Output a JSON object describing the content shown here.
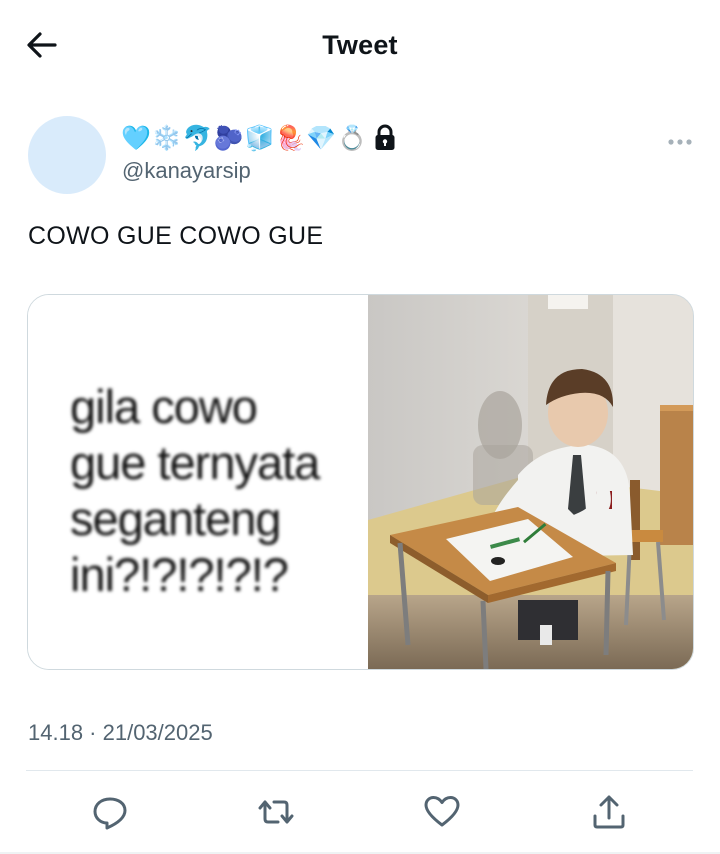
{
  "header": {
    "title": "Tweet",
    "back_icon": "arrow-left-icon"
  },
  "tweet": {
    "display_name_emojis": [
      "🩵",
      "❄️",
      "🐬",
      "🫐",
      "🧊",
      "🪼",
      "💎",
      "💍"
    ],
    "lock_icon": "lock-icon",
    "handle": "@kanayarsip",
    "text": "COWO GUE COWO GUE",
    "media": {
      "caption_lines": [
        "gila      cowo",
        "gue ternyata",
        "seganteng",
        "ini?!?!?!?!?"
      ]
    },
    "timestamp": "14.18 · 21/03/2025"
  },
  "actions": [
    "reply-icon",
    "retweet-icon",
    "like-icon",
    "share-icon"
  ],
  "colors": {
    "text": "#0f1419",
    "secondary": "#536471",
    "avatar": "#d9ebfb",
    "border": "#cfd9de"
  }
}
